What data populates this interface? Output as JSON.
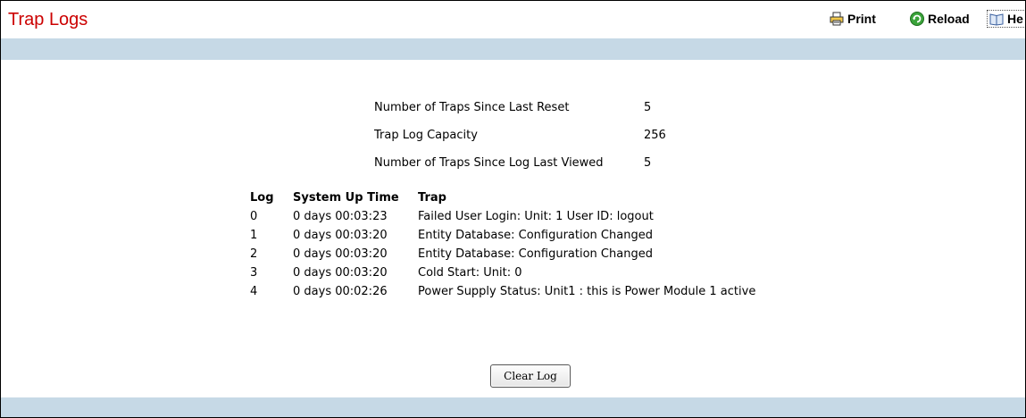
{
  "header": {
    "title": "Trap Logs",
    "toolbar": {
      "print_label": "Print",
      "reload_label": "Reload",
      "help_label": "He",
      "print_icon": "printer-icon",
      "reload_icon": "reload-icon",
      "help_icon": "book-icon"
    }
  },
  "colors": {
    "title": "#cc0000",
    "band": "#c6d9e6"
  },
  "summary": [
    {
      "label": "Number of Traps Since Last Reset",
      "value": "5"
    },
    {
      "label": "Trap Log Capacity",
      "value": "256"
    },
    {
      "label": "Number of Traps Since Log Last Viewed",
      "value": "5"
    }
  ],
  "log_table": {
    "columns": [
      "Log",
      "System Up Time",
      "Trap"
    ],
    "rows": [
      {
        "log": "0",
        "time": "0 days 00:03:23",
        "trap": "Failed User Login: Unit: 1 User ID: logout"
      },
      {
        "log": "1",
        "time": "0 days 00:03:20",
        "trap": "Entity Database: Configuration Changed"
      },
      {
        "log": "2",
        "time": "0 days 00:03:20",
        "trap": "Entity Database: Configuration Changed"
      },
      {
        "log": "3",
        "time": "0 days 00:03:20",
        "trap": "Cold Start: Unit: 0"
      },
      {
        "log": "4",
        "time": "0 days 00:02:26",
        "trap": "Power Supply Status: Unit1 : this is Power Module 1 active"
      }
    ]
  },
  "actions": {
    "clear_log_label": "Clear Log"
  }
}
